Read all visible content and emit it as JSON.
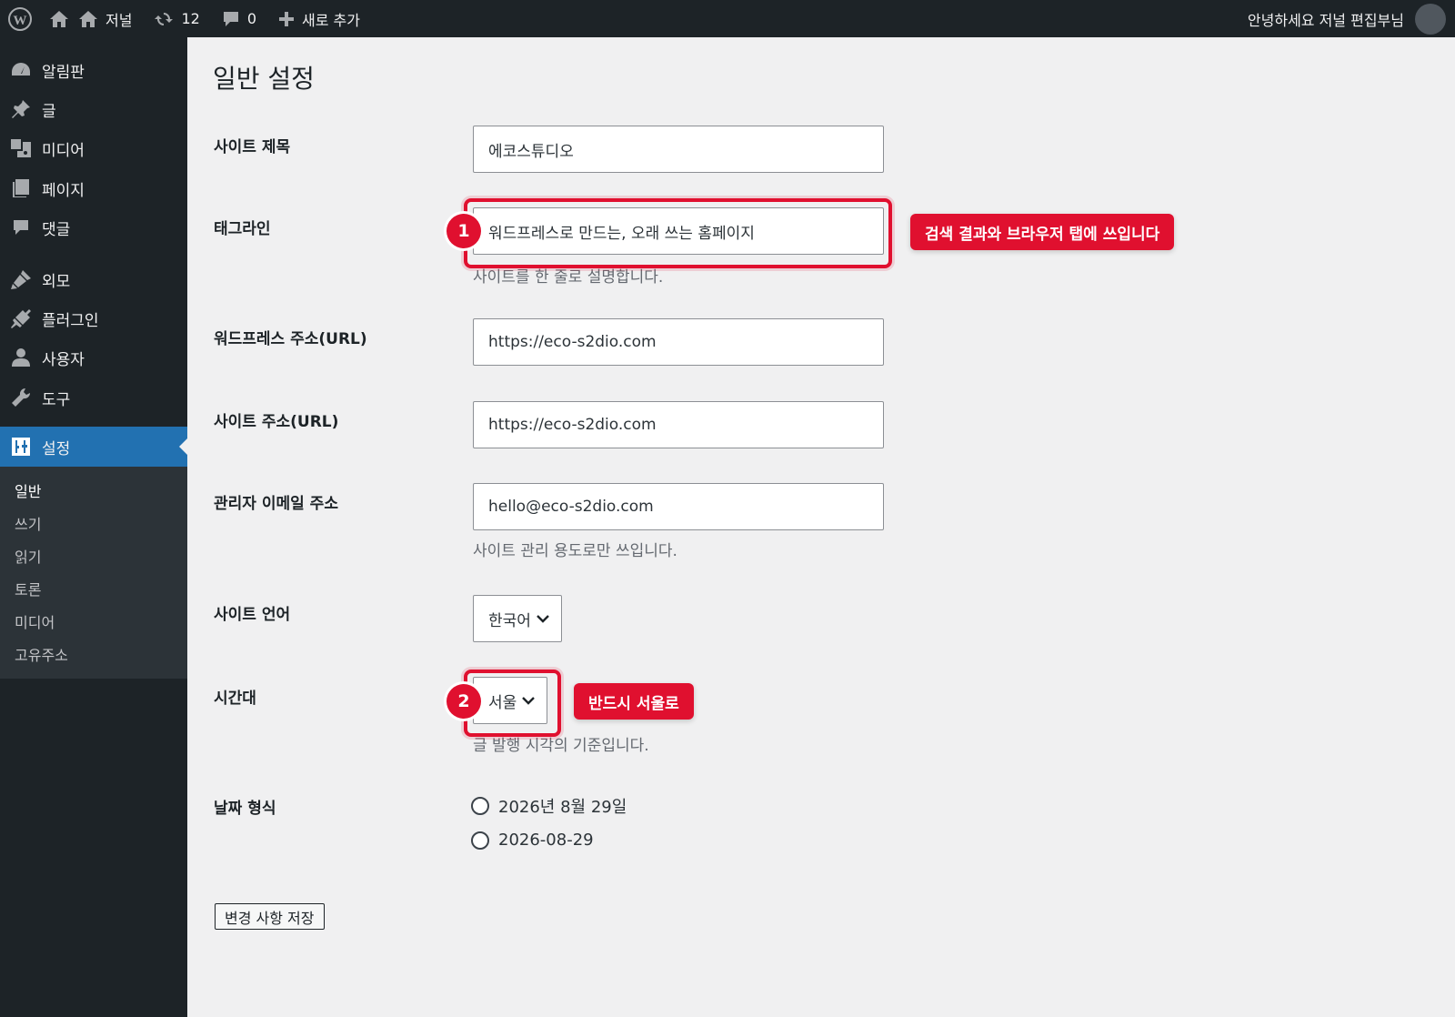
{
  "adminbar": {
    "site_name": "저널",
    "updates_count": "12",
    "comments_count": "0",
    "new_label": "새로 추가",
    "greeting": "안녕하세요 저널 편집부님"
  },
  "sidebar": {
    "items": [
      {
        "label": "알림판",
        "icon": "dashboard-icon"
      },
      {
        "label": "글",
        "icon": "pin-icon"
      },
      {
        "label": "미디어",
        "icon": "media-icon"
      },
      {
        "label": "페이지",
        "icon": "page-icon"
      },
      {
        "label": "댓글",
        "icon": "comment-icon"
      },
      {
        "label": "외모",
        "icon": "brush-icon"
      },
      {
        "label": "플러그인",
        "icon": "plugin-icon"
      },
      {
        "label": "사용자",
        "icon": "user-icon"
      },
      {
        "label": "도구",
        "icon": "wrench-icon"
      },
      {
        "label": "설정",
        "icon": "settings-icon"
      }
    ],
    "submenu": [
      "일반",
      "쓰기",
      "읽기",
      "토론",
      "미디어",
      "고유주소"
    ]
  },
  "main": {
    "title": "일반 설정",
    "site_title": {
      "label": "사이트 제목",
      "value": "에코스튜디오"
    },
    "tagline": {
      "label": "태그라인",
      "value": "워드프레스로 만드는, 오래 쓰는 홈페이지",
      "description": "사이트를 한 줄로 설명합니다."
    },
    "wp_url": {
      "label": "워드프레스 주소(URL)",
      "value": "https://eco-s2dio.com"
    },
    "site_url": {
      "label": "사이트 주소(URL)",
      "value": "https://eco-s2dio.com"
    },
    "admin_email": {
      "label": "관리자 이메일 주소",
      "value": "hello@eco-s2dio.com",
      "description": "사이트 관리 용도로만 쓰입니다."
    },
    "site_language": {
      "label": "사이트 언어",
      "value": "한국어"
    },
    "timezone": {
      "label": "시간대",
      "value": "서울",
      "description": "글 발행 시각의 기준입니다."
    },
    "date_format": {
      "label": "날짜 형식",
      "options": [
        "2026년 8월 29일",
        "2026-08-29"
      ]
    },
    "save_label": "변경 사항 저장"
  },
  "annotations": {
    "step1": "1",
    "callout1": "검색 결과와 브라우저 탭에 쓰입니다",
    "step2": "2",
    "callout2": "반드시 서울로",
    "accent": "#e0102f"
  },
  "colors": {
    "admin_bg": "#1d2327",
    "primary": "#2271b1",
    "page_bg": "#f0f0f1"
  }
}
